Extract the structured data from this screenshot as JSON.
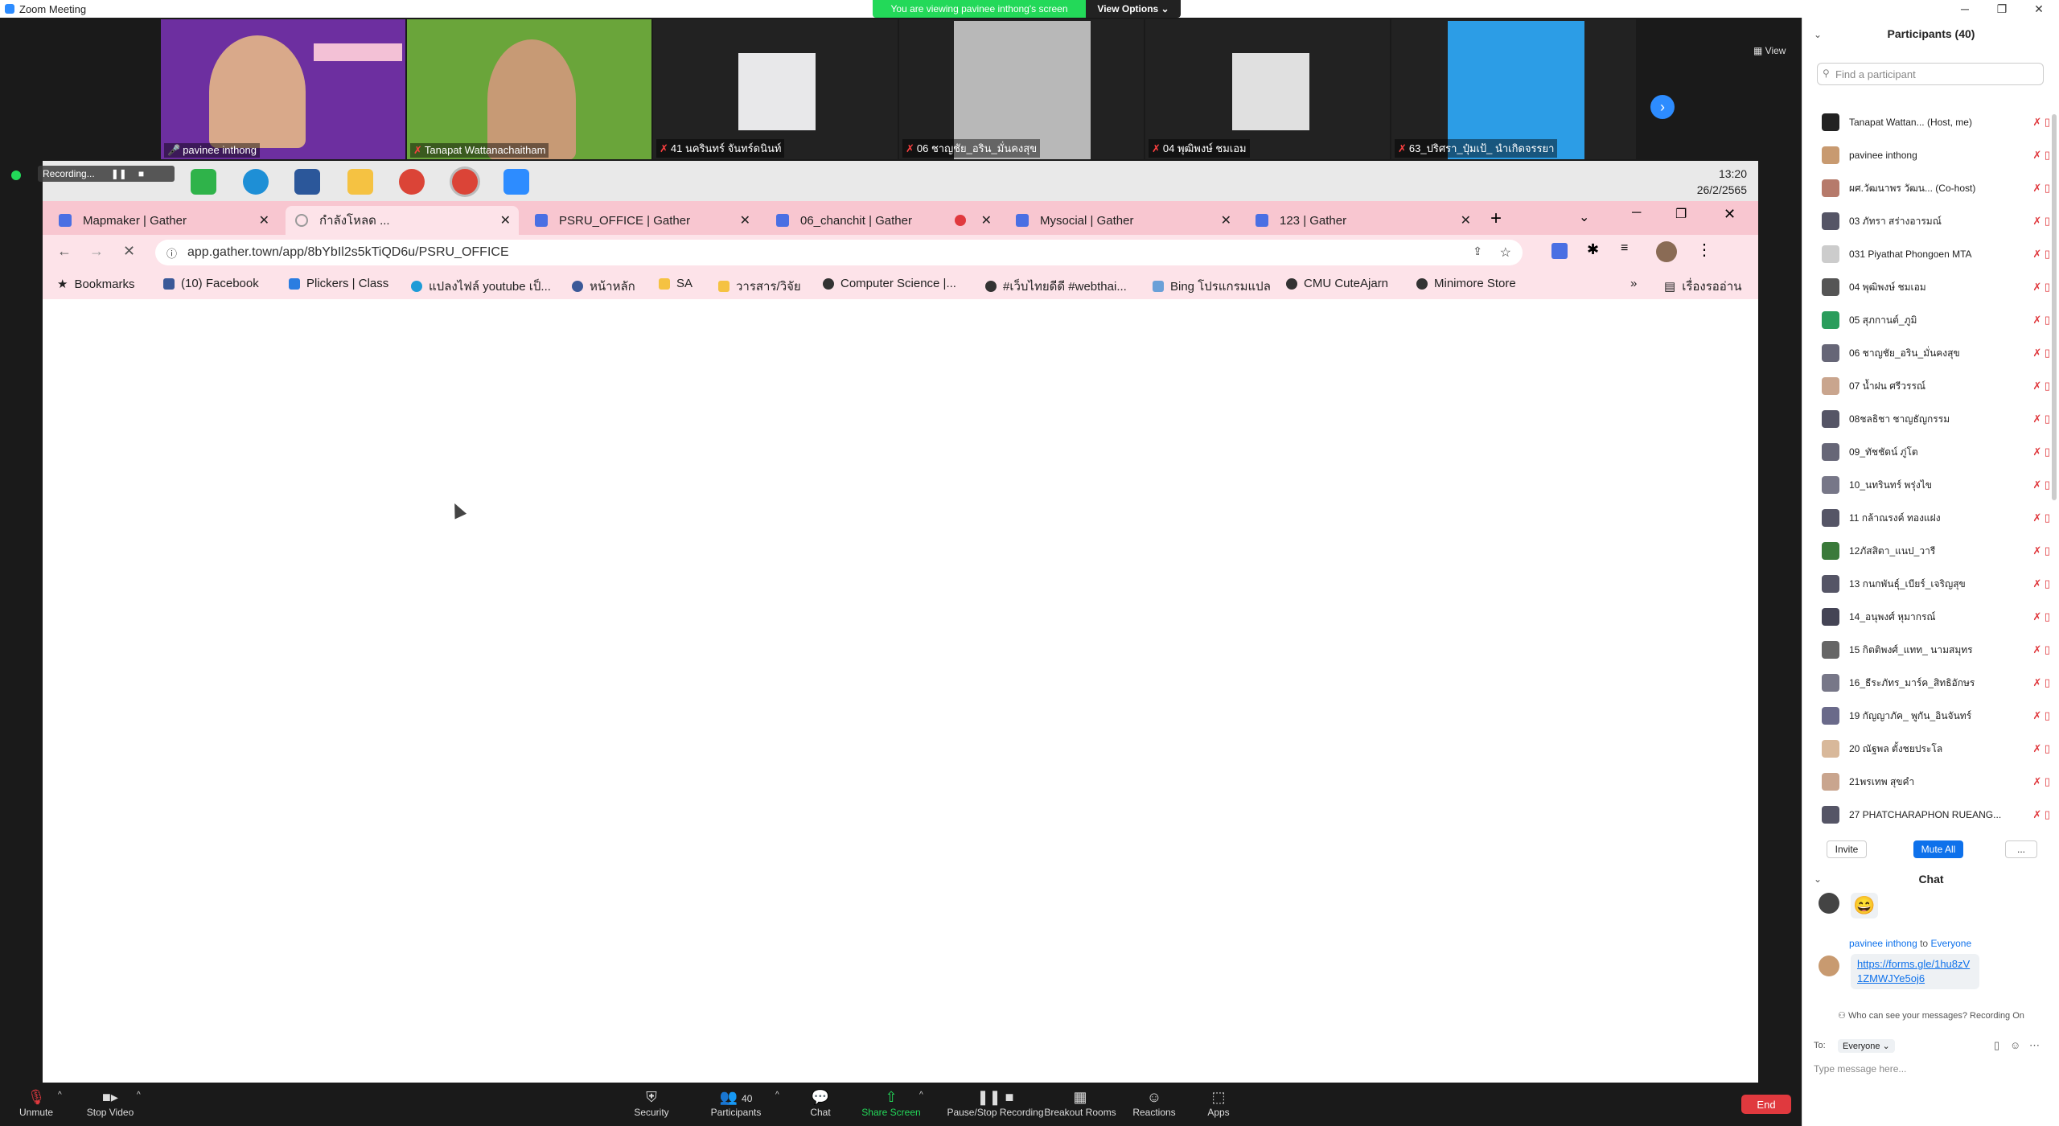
{
  "window": {
    "title": "Zoom Meeting"
  },
  "banner": {
    "viewing": "You are viewing pavinee inthong's screen",
    "view_options": "View Options ⌄"
  },
  "video_strip": {
    "view_label": "View",
    "tiles": [
      {
        "name": "pavinee inthong",
        "bg": "#7a3ca8"
      },
      {
        "name": "Tanapat Wattanachaitham",
        "bg": "#5aa53a"
      },
      {
        "name": "41 นครินทร์ จันทร์ดนินท์",
        "bg": "#2a2a2a"
      },
      {
        "name": "06 ชาญชัย_อริน_มั่นคงสุข",
        "bg": "#2a2a2a"
      },
      {
        "name": "04 พุฒิพงษ์ ชมเอม",
        "bg": "#2a2a2a"
      },
      {
        "name": "63_ปริศรา_ปุ๋มเป้_ นำเกิดจรรยา",
        "bg": "#2a2a2a"
      }
    ]
  },
  "shared_screen": {
    "recording_label": "Recording...",
    "clock_time": "13:20",
    "clock_date": "26/2/2565",
    "tabs": [
      {
        "title": "Mapmaker | Gather"
      },
      {
        "title": "กำลังโหลด ..."
      },
      {
        "title": "PSRU_OFFICE | Gather"
      },
      {
        "title": "06_chanchit | Gather"
      },
      {
        "title": "Mysocial | Gather"
      },
      {
        "title": "123 | Gather"
      }
    ],
    "url": "app.gather.town/app/8bYbIl2s5kTiQD6u/PSRU_OFFICE",
    "bookmarks": [
      "Bookmarks",
      "(10) Facebook",
      "Plickers | Class",
      "แปลงไฟล์ youtube เป็...",
      "หน้าหลัก",
      "SA",
      "วารสาร/วิจัย",
      "Computer Science |...",
      "#เว็บไทยดีดี #webthai...",
      "Bing โปรแกรมแปล",
      "CMU CuteAjarn",
      "Minimore Store"
    ],
    "reading_list": "เรื่องรออ่าน"
  },
  "participants": {
    "header": "Participants (40)",
    "search_placeholder": "Find a participant",
    "list": [
      "Tanapat Wattan... (Host, me)",
      "pavinee inthong",
      "ผศ.วัฒนาพร วัฒน... (Co-host)",
      "03 ภัทรา สร่างอารมณ์",
      "031 Piyathat Phongoen MTA",
      "04 พุฒิพงษ์ ชมเอม",
      "05 สุภกานต์_ภูมิ",
      "06 ชาญชัย_อริน_มั่นคงสุข",
      "07 น้ำฝน ศรีวรรณ์",
      "08ชลธิชา ชาญธัญกรรม",
      "09_ทัชชัดน์ ภู่โต",
      "10_นทรินทร์ พรุ่งไข",
      "11 กล้าณรงค์ ทองแฝง",
      "12ภัสสิตา_แนป_วารี",
      "13 กนกพันธุ์_เบียร์_เจริญสุข",
      "14_อนุพงศ์ หุมากรณ์",
      "15 กิตติพงศ์_แทท_ นามสมุทร",
      "16_ธีระภัทร_มาร์ค_สิทธิอักษร",
      "19 กัญญาภัค_ พูกัน_อินจันทร์",
      "20 ณัฐพล ตั้งชยประโล",
      "21พรเทพ สุขคำ",
      "27 PHATCHARAPHON RUEANG..."
    ],
    "invite_label": "Invite",
    "mute_all_label": "Mute All",
    "more_label": "..."
  },
  "chat": {
    "header": "Chat",
    "emoji": "😄",
    "sender": "pavinee inthong",
    "to_word": "to",
    "recipient": "Everyone",
    "link": "https://forms.gle/1hu8zV1ZMWJYe5oj6",
    "privacy_note": "Who can see your messages? Recording On",
    "to_label": "To:",
    "to_value": "Everyone ⌄",
    "input_placeholder": "Type message here..."
  },
  "controls": {
    "unmute": "Unmute",
    "stop_video": "Stop Video",
    "security": "Security",
    "participants": "Participants",
    "participant_count": "40",
    "chat": "Chat",
    "share_screen": "Share Screen",
    "recording": "Pause/Stop Recording",
    "breakout": "Breakout Rooms",
    "reactions": "Reactions",
    "apps": "Apps",
    "end": "End"
  }
}
